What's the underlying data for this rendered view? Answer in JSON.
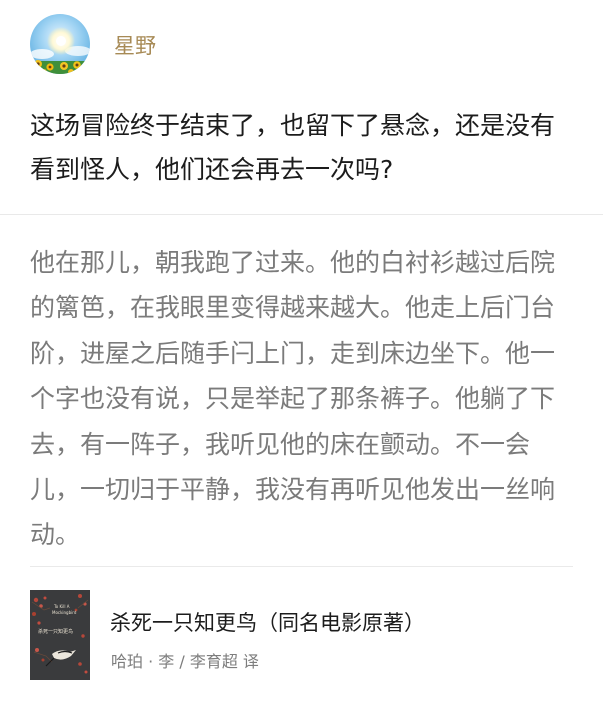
{
  "user": {
    "name": "星野",
    "avatar_icon": "sunny-sky-sunflower-avatar"
  },
  "comment": {
    "text": "这场冒险终于结束了，也留下了悬念，还是没有看到怪人，他们还会再去一次吗?"
  },
  "quote": {
    "text": "他在那儿，朝我跑了过来。他的白衬衫越过后院的篱笆，在我眼里变得越来越大。他走上后门台阶，进屋之后随手闩上门，走到床边坐下。他一个字也没有说，只是举起了那条裤子。他躺了下去，有一阵子，我听见他的床在颤动。不一会儿，一切归于平静，我没有再听见他发出一丝响动。"
  },
  "book": {
    "title": "杀死一只知更鸟（同名电影原著）",
    "author": "哈珀 · 李 / 李育超 译",
    "cover_line_1": "To Kill A",
    "cover_line_2": "Mockingbird",
    "cover_line_3": "杀死一只知更鸟"
  },
  "colors": {
    "username": "#a78a55",
    "comment_text": "#1c1c1c",
    "quote_text": "#7b7b7b",
    "author_text": "#7d7d7d",
    "divider": "#e9e9e9",
    "cover_bg": "#3a3b3d"
  }
}
